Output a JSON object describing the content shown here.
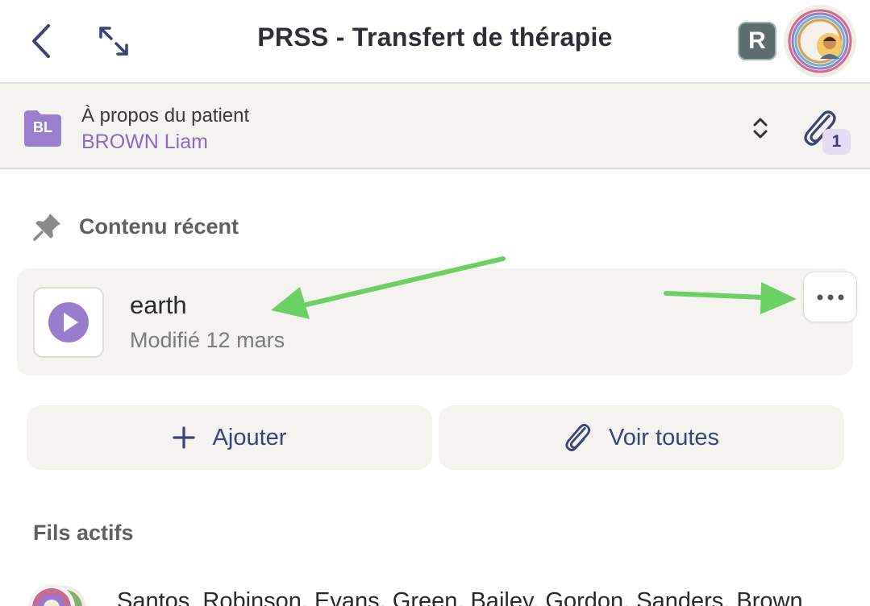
{
  "header": {
    "title": "PRSS - Transfert de thérapie",
    "back_icon": "chevron-left-icon",
    "expand_icon": "expand-arrows-icon",
    "badge_letter": "R"
  },
  "patient": {
    "initials": "BL",
    "label": "À propos du patient",
    "name": "BROWN Liam",
    "attachment_count": "1"
  },
  "recent": {
    "heading": "Contenu récent",
    "item": {
      "name": "earth",
      "modified": "Modifié 12 mars"
    }
  },
  "actions": {
    "add_label": "Ajouter",
    "view_all_label": "Voir toutes"
  },
  "threads": {
    "heading": "Fils actifs",
    "first_thread_names": "Santos, Robinson, Evans, Green, Bailey, Gordon, Sanders, Brown"
  },
  "colors": {
    "accent_purple": "#8a6ac2",
    "arrow_green": "#6cd164",
    "button_text": "#3b4378",
    "panel_bg": "#f4f3ef"
  }
}
